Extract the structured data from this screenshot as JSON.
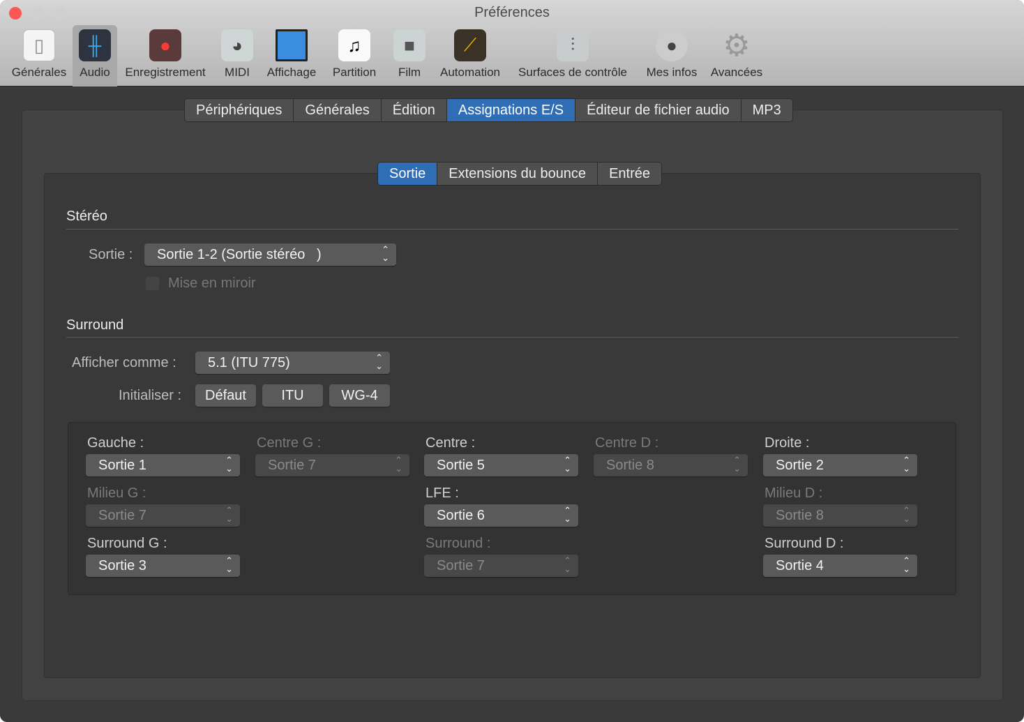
{
  "window": {
    "title": "Préférences"
  },
  "toolbar": [
    {
      "label": "Générales",
      "icon": "switch-icon"
    },
    {
      "label": "Audio",
      "icon": "waveform-icon",
      "selected": true
    },
    {
      "label": "Enregistrement",
      "icon": "record-icon"
    },
    {
      "label": "MIDI",
      "icon": "midi-connector-icon"
    },
    {
      "label": "Affichage",
      "icon": "display-icon"
    },
    {
      "label": "Partition",
      "icon": "music-note-icon"
    },
    {
      "label": "Film",
      "icon": "video-camera-icon"
    },
    {
      "label": "Automation",
      "icon": "automation-icon"
    },
    {
      "label": "Surfaces de contrôle",
      "icon": "faders-icon"
    },
    {
      "label": "Mes infos",
      "icon": "user-icon"
    },
    {
      "label": "Avancées",
      "icon": "gear-icon"
    }
  ],
  "tabs": [
    "Périphériques",
    "Générales",
    "Édition",
    "Assignations E/S",
    "Éditeur de fichier audio",
    "MP3"
  ],
  "subtabs": [
    "Sortie",
    "Extensions du bounce",
    "Entrée"
  ],
  "stereo": {
    "heading": "Stéréo",
    "output_label": "Sortie :",
    "output_value": "Sortie 1-2 (Sortie stéréo   )",
    "mirror_label": "Mise en miroir",
    "mirror_checked": false
  },
  "surround": {
    "heading": "Surround",
    "display_label": "Afficher comme :",
    "display_value": "5.1 (ITU 775)",
    "init_label": "Initialiser :",
    "init_buttons": [
      "Défaut",
      "ITU",
      "WG-4"
    ]
  },
  "channels": [
    {
      "label": "Gauche :",
      "value": "Sortie 1",
      "enabled": true
    },
    {
      "label": "Centre G :",
      "value": "Sortie 7",
      "enabled": false
    },
    {
      "label": "Centre :",
      "value": "Sortie 5",
      "enabled": true
    },
    {
      "label": "Centre D :",
      "value": "Sortie 8",
      "enabled": false
    },
    {
      "label": "Droite :",
      "value": "Sortie 2",
      "enabled": true
    },
    {
      "label": "Milieu G :",
      "value": "Sortie 7",
      "enabled": false
    },
    {
      "label": "LFE :",
      "value": "Sortie 6",
      "enabled": true
    },
    {
      "label": "Milieu D :",
      "value": "Sortie 8",
      "enabled": false
    },
    {
      "label": "Surround G :",
      "value": "Sortie 3",
      "enabled": true
    },
    {
      "label": "Surround :",
      "value": "Sortie 7",
      "enabled": false
    },
    {
      "label": "Surround D :",
      "value": "Sortie 4",
      "enabled": true
    }
  ],
  "colors": {
    "accent": "#2f6db5",
    "close": "#fc5753"
  }
}
